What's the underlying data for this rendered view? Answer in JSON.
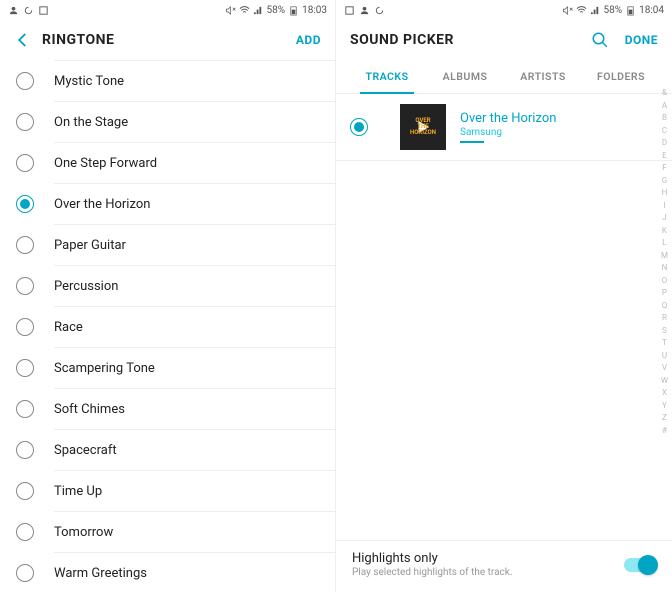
{
  "left": {
    "status": {
      "battery": "58%",
      "time": "18:03"
    },
    "title": "RINGTONE",
    "action": "ADD",
    "items": [
      {
        "label": "Mystic Tone",
        "selected": false
      },
      {
        "label": "On the Stage",
        "selected": false
      },
      {
        "label": "One Step Forward",
        "selected": false
      },
      {
        "label": "Over the Horizon",
        "selected": true
      },
      {
        "label": "Paper Guitar",
        "selected": false
      },
      {
        "label": "Percussion",
        "selected": false
      },
      {
        "label": "Race",
        "selected": false
      },
      {
        "label": "Scampering Tone",
        "selected": false
      },
      {
        "label": "Soft Chimes",
        "selected": false
      },
      {
        "label": "Spacecraft",
        "selected": false
      },
      {
        "label": "Time Up",
        "selected": false
      },
      {
        "label": "Tomorrow",
        "selected": false
      },
      {
        "label": "Warm Greetings",
        "selected": false
      }
    ]
  },
  "right": {
    "status": {
      "battery": "58%",
      "time": "18:04"
    },
    "title": "SOUND PICKER",
    "action": "DONE",
    "tabs": [
      "TRACKS",
      "ALBUMS",
      "ARTISTS",
      "FOLDERS"
    ],
    "active_tab": 0,
    "track": {
      "title": "Over the Horizon",
      "artist": "Samsung",
      "selected": true
    },
    "index": [
      "&",
      "A",
      "B",
      "C",
      "D",
      "E",
      "F",
      "G",
      "H",
      "I",
      "J",
      "K",
      "L",
      "M",
      "N",
      "O",
      "P",
      "Q",
      "R",
      "S",
      "T",
      "U",
      "V",
      "W",
      "X",
      "Y",
      "Z",
      "#"
    ],
    "footer": {
      "title": "Highlights only",
      "sub": "Play selected highlights of the track.",
      "toggle": true
    }
  }
}
